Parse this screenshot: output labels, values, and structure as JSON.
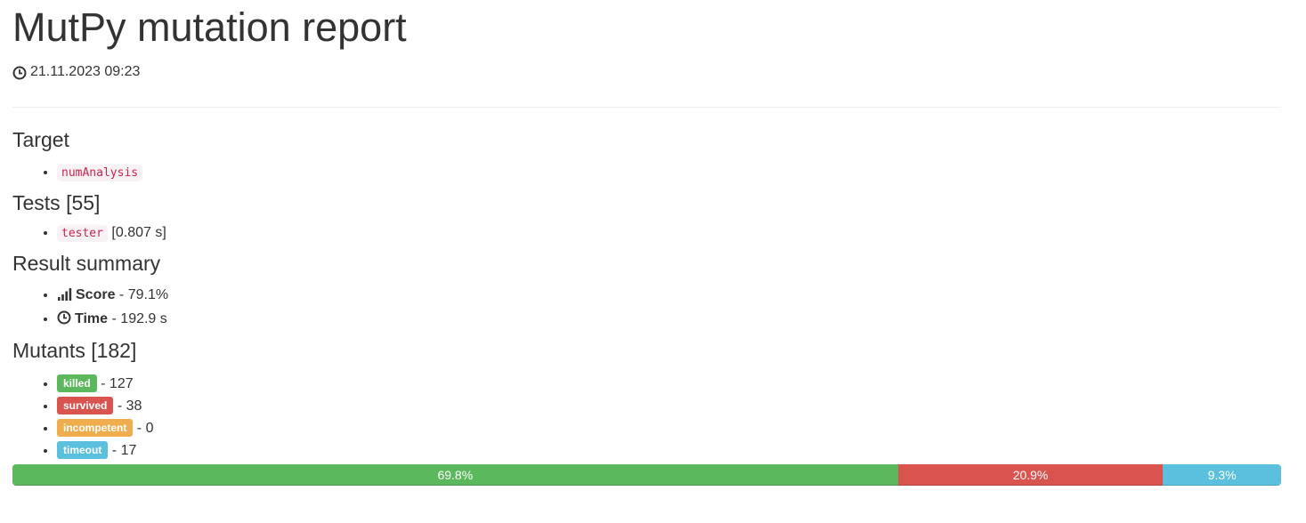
{
  "header": {
    "title": "MutPy mutation report",
    "timestamp": "21.11.2023 09:23"
  },
  "target": {
    "heading": "Target",
    "items": [
      "numAnalysis"
    ]
  },
  "tests": {
    "heading": "Tests [55]",
    "items": [
      {
        "name": "tester",
        "time": "[0.807 s]"
      }
    ]
  },
  "summary": {
    "heading": "Result summary",
    "score_label": "Score",
    "score_value": "- 79.1%",
    "time_label": "Time",
    "time_value": "- 192.9 s"
  },
  "mutants": {
    "heading": "Mutants [182]",
    "items": [
      {
        "label": "killed",
        "value": "- 127",
        "color": "#5cb85c"
      },
      {
        "label": "survived",
        "value": "- 38",
        "color": "#d9534f"
      },
      {
        "label": "incompetent",
        "value": "- 0",
        "color": "#f0ad4e"
      },
      {
        "label": "timeout",
        "value": "- 17",
        "color": "#5bc0de"
      }
    ]
  },
  "progress": {
    "segments": [
      {
        "label": "69.8%",
        "percent": 69.8,
        "color": "#5cb85c"
      },
      {
        "label": "20.9%",
        "percent": 20.9,
        "color": "#d9534f"
      },
      {
        "label": "9.3%",
        "percent": 9.3,
        "color": "#5bc0de"
      }
    ]
  }
}
